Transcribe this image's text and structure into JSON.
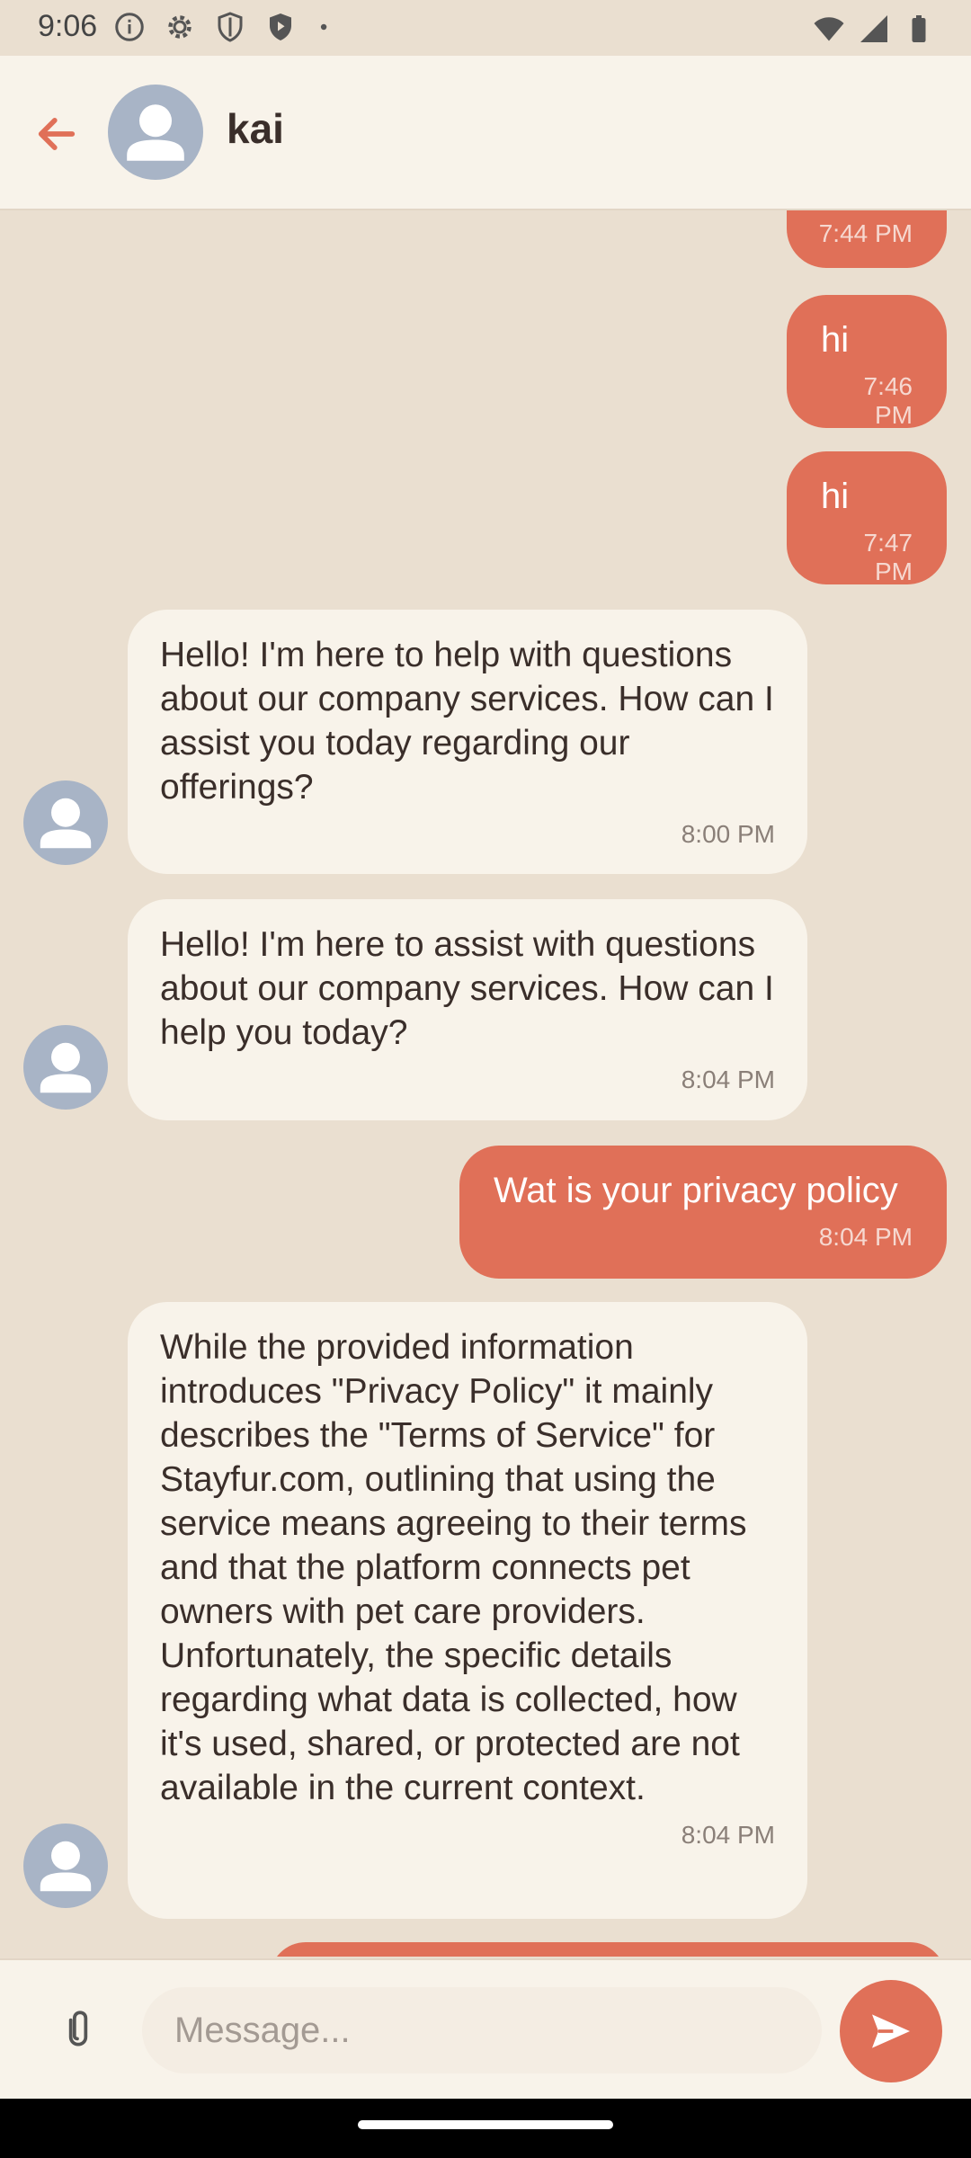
{
  "status_bar": {
    "time": "9:06",
    "left_icons": [
      "info-icon",
      "gear-icon",
      "shield-icon",
      "play-protect-icon",
      "dot-icon"
    ],
    "right_icons": [
      "wifi-icon",
      "signal-icon",
      "battery-icon"
    ]
  },
  "header": {
    "contact_name": "kai",
    "back_icon": "arrow-left-icon",
    "avatar_icon": "person-avatar-icon"
  },
  "messages": [
    {
      "direction": "out",
      "text": "",
      "time": "7:44 PM"
    },
    {
      "direction": "out",
      "text": "hi",
      "time": "7:46 PM"
    },
    {
      "direction": "out",
      "text": "hi",
      "time": "7:47 PM"
    },
    {
      "direction": "in",
      "text": "Hello! I'm here to help with questions about our company services. How can I assist you today regarding our offerings?",
      "time": "8:00 PM"
    },
    {
      "direction": "in",
      "text": "Hello! I'm here to assist with questions about our company services. How can I help you today?",
      "time": "8:04 PM"
    },
    {
      "direction": "out",
      "text": "Wat is your privacy policy",
      "time": "8:04 PM"
    },
    {
      "direction": "in",
      "text": "While the provided information introduces \"Privacy Policy\" it mainly describes the \"Terms of Service\" for Stayfur.com, outlining that using the service means agreeing to their terms and that the platform connects pet owners with pet care providers. Unfortunately, the specific details regarding what data is collected, how it's used, shared, or protected are not available in the current context.",
      "time": "8:04 PM"
    }
  ],
  "composer": {
    "placeholder": "Message...",
    "attach_icon": "paperclip-icon",
    "send_icon": "send-icon"
  },
  "colors": {
    "accent": "#e07058",
    "background": "#eadfd0",
    "surface": "#f8f3ea",
    "avatar": "#a8b4c6"
  }
}
